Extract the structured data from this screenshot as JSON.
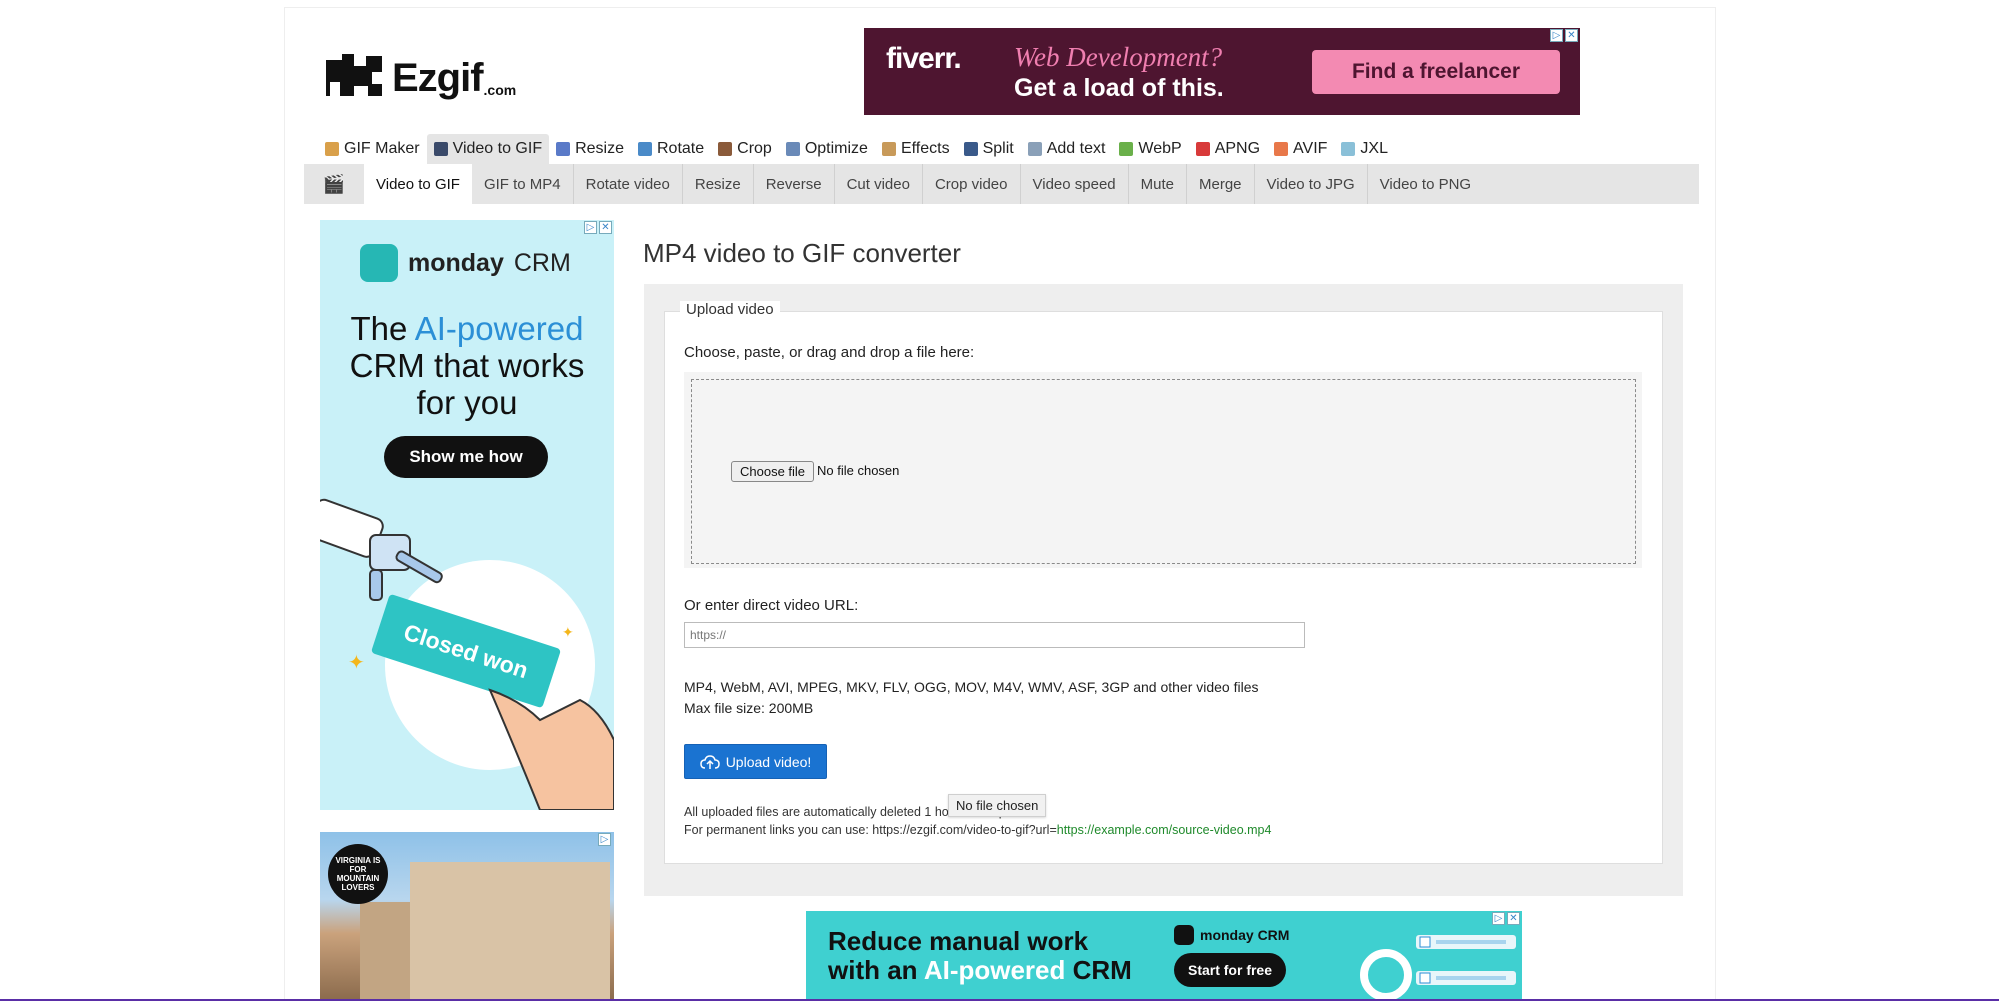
{
  "logo": {
    "name": "Ezgif",
    "suffix": ".com"
  },
  "ad_top": {
    "brand": "fiverr.",
    "line1": "Web Development?",
    "line2": "Get a load of this.",
    "cta": "Find a freelancer"
  },
  "main_nav": [
    {
      "label": "GIF Maker",
      "icon": "gif-maker-icon",
      "color": "#d9a04a"
    },
    {
      "label": "Video to GIF",
      "icon": "film-icon",
      "color": "#3a4a6a",
      "active": true
    },
    {
      "label": "Resize",
      "icon": "resize-icon",
      "color": "#5a7ac8"
    },
    {
      "label": "Rotate",
      "icon": "rotate-icon",
      "color": "#4a8ac8"
    },
    {
      "label": "Crop",
      "icon": "crop-icon",
      "color": "#8a5a3a"
    },
    {
      "label": "Optimize",
      "icon": "optimize-icon",
      "color": "#6a8ab8"
    },
    {
      "label": "Effects",
      "icon": "effects-icon",
      "color": "#c89a5a"
    },
    {
      "label": "Split",
      "icon": "split-icon",
      "color": "#3a5a8a"
    },
    {
      "label": "Add text",
      "icon": "add-text-icon",
      "color": "#8aa0b8"
    },
    {
      "label": "WebP",
      "icon": "webp-icon",
      "color": "#6ab04a"
    },
    {
      "label": "APNG",
      "icon": "apng-icon",
      "color": "#d83a3a"
    },
    {
      "label": "AVIF",
      "icon": "avif-icon",
      "color": "#e8784a"
    },
    {
      "label": "JXL",
      "icon": "jxl-icon",
      "color": "#8ac0d8"
    }
  ],
  "sub_nav": [
    {
      "label": "Video to GIF",
      "active": true
    },
    {
      "label": "GIF to MP4"
    },
    {
      "label": "Rotate video"
    },
    {
      "label": "Resize"
    },
    {
      "label": "Reverse"
    },
    {
      "label": "Cut video"
    },
    {
      "label": "Crop video"
    },
    {
      "label": "Video speed"
    },
    {
      "label": "Mute"
    },
    {
      "label": "Merge"
    },
    {
      "label": "Video to JPG"
    },
    {
      "label": "Video to PNG"
    }
  ],
  "ad_left1": {
    "brand": "monday",
    "brand2": "CRM",
    "head1": "The ",
    "head_hl": "AI-powered",
    "head2": "CRM that works",
    "head3": "for you",
    "cta": "Show me how",
    "card": "Closed won"
  },
  "ad_left2": {
    "badge": "VIRGINIA IS FOR MOUNTAIN LOVERS"
  },
  "main": {
    "title": "MP4 video to GIF converter",
    "legend": "Upload video",
    "choose_label": "Choose, paste, or drag and drop a file here:",
    "choose_button": "Choose file",
    "no_file": "No file chosen",
    "url_label": "Or enter direct video URL:",
    "url_placeholder": "https://",
    "formats": "MP4, WebM, AVI, MPEG, MKV, FLV, OGG, MOV, M4V, WMV, ASF, 3GP and other video files",
    "max_size": "Max file size: 200MB",
    "upload_button": "Upload video!",
    "note1": "All uploaded files are automatically deleted 1 hour after upload.",
    "note2_prefix": "For permanent links you can use: https://ezgif.com/video-to-gif?url=",
    "note2_link": "https://example.com/source-video.mp4",
    "tooltip": "No file chosen"
  },
  "ad_bottom": {
    "line1": "Reduce manual work",
    "line2_prefix": "with an ",
    "line2_hl": "AI-powered",
    "line2_suffix": " CRM",
    "brand": "monday CRM",
    "cta": "Start for free"
  }
}
